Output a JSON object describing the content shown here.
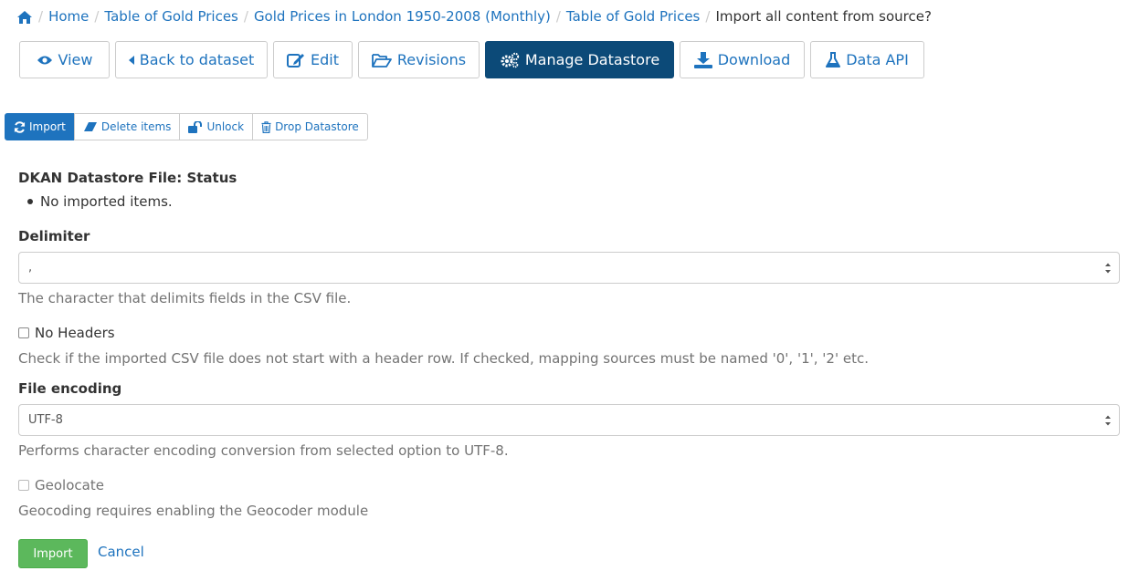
{
  "breadcrumb": {
    "items": [
      "Home",
      "Table of Gold Prices",
      "Gold Prices in London 1950-2008 (Monthly)",
      "Table of Gold Prices"
    ],
    "current": "Import all content from source?",
    "separator": "/"
  },
  "tabs": [
    {
      "label": "View",
      "icon": "eye-icon",
      "active": false
    },
    {
      "label": "Back to dataset",
      "icon": "caret-left-icon",
      "active": false
    },
    {
      "label": "Edit",
      "icon": "edit-icon",
      "active": false
    },
    {
      "label": "Revisions",
      "icon": "folder-open-icon",
      "active": false
    },
    {
      "label": "Manage Datastore",
      "icon": "gears-icon",
      "active": true
    },
    {
      "label": "Download",
      "icon": "download-icon",
      "active": false
    },
    {
      "label": "Data API",
      "icon": "flask-icon",
      "active": false
    }
  ],
  "actions": [
    {
      "label": "Import",
      "icon": "refresh-icon",
      "active": true
    },
    {
      "label": "Delete items",
      "icon": "eraser-icon",
      "active": false
    },
    {
      "label": "Unlock",
      "icon": "unlock-icon",
      "active": false
    },
    {
      "label": "Drop Datastore",
      "icon": "trash-icon",
      "active": false
    }
  ],
  "status": {
    "heading": "DKAN Datastore File: Status",
    "item": "No imported items."
  },
  "delimiter": {
    "label": "Delimiter",
    "value": ",",
    "help": "The character that delimits fields in the CSV file."
  },
  "no_headers": {
    "label": "No Headers",
    "checked": false,
    "help": "Check if the imported CSV file does not start with a header row. If checked, mapping sources must be named '0', '1', '2' etc."
  },
  "encoding": {
    "label": "File encoding",
    "value": "UTF-8",
    "help": "Performs character encoding conversion from selected option to UTF-8."
  },
  "geolocate": {
    "label": "Geolocate",
    "checked": false,
    "disabled": true,
    "help": "Geocoding requires enabling the Geocoder module"
  },
  "buttons": {
    "submit": "Import",
    "cancel": "Cancel"
  },
  "colors": {
    "link": "#1e73be",
    "active_tab": "#0c4a78",
    "active_action": "#1e73be",
    "submit": "#5cb85c"
  }
}
